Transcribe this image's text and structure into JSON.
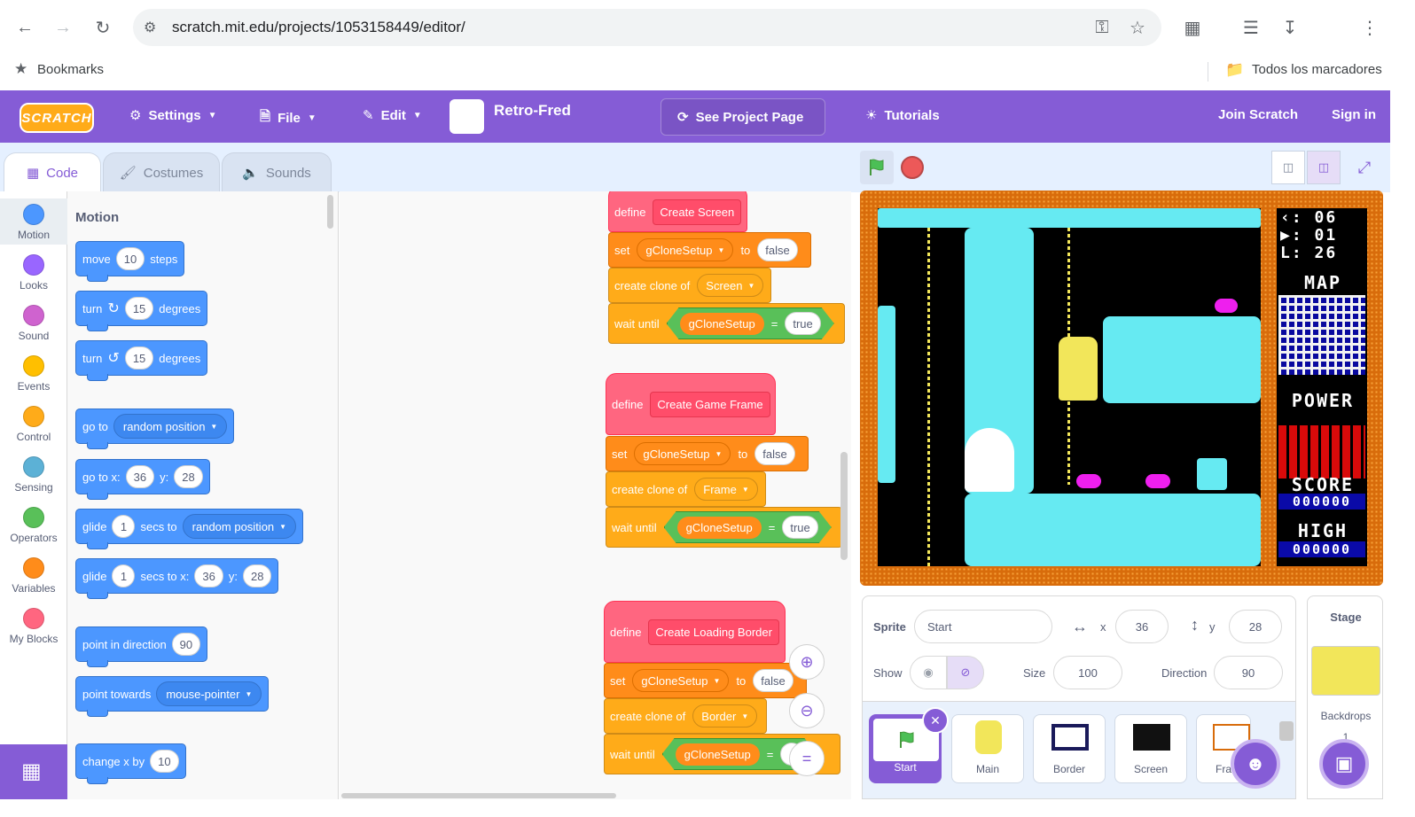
{
  "browser": {
    "url": "scratch.mit.edu/projects/1053158449/editor/",
    "bookmarks_label": "Bookmarks",
    "all_bookmarks_label": "Todos los marcadores"
  },
  "menu": {
    "logo": "SCRATCH",
    "settings": "Settings",
    "file": "File",
    "edit": "Edit",
    "project_title": "Retro-Fred",
    "see_project_page": "See Project Page",
    "tutorials": "Tutorials",
    "join": "Join Scratch",
    "sign_in": "Sign in"
  },
  "tabs": {
    "code": "Code",
    "costumes": "Costumes",
    "sounds": "Sounds"
  },
  "categories": [
    {
      "label": "Motion",
      "color": "#4c97ff"
    },
    {
      "label": "Looks",
      "color": "#9966ff"
    },
    {
      "label": "Sound",
      "color": "#cf63cf"
    },
    {
      "label": "Events",
      "color": "#ffbf00"
    },
    {
      "label": "Control",
      "color": "#ffab19"
    },
    {
      "label": "Sensing",
      "color": "#5cb1d6"
    },
    {
      "label": "Operators",
      "color": "#59c059"
    },
    {
      "label": "Variables",
      "color": "#ff8c1a"
    },
    {
      "label": "My Blocks",
      "color": "#ff6680"
    }
  ],
  "palette": {
    "section": "Motion",
    "move": {
      "a": "move",
      "v": "10",
      "b": "steps"
    },
    "turn_right": {
      "a": "turn",
      "v": "15",
      "b": "degrees"
    },
    "turn_left": {
      "a": "turn",
      "v": "15",
      "b": "degrees"
    },
    "goto": {
      "a": "go to",
      "d": "random position"
    },
    "gotoxy": {
      "a": "go to x:",
      "x": "36",
      "b": "y:",
      "y": "28"
    },
    "glide": {
      "a": "glide",
      "v": "1",
      "b": "secs to",
      "d": "random position"
    },
    "glidexy": {
      "a": "glide",
      "v": "1",
      "b": "secs to x:",
      "x": "36",
      "c": "y:",
      "y": "28"
    },
    "point_dir": {
      "a": "point in direction",
      "v": "90"
    },
    "point_towards": {
      "a": "point towards",
      "d": "mouse-pointer"
    },
    "change_x": {
      "a": "change x by",
      "v": "10"
    }
  },
  "scripts": [
    {
      "define": "define",
      "name": "Create Screen",
      "set": "set",
      "var": "gCloneSetup",
      "to": "to",
      "val": "false",
      "clone": "create clone of",
      "target": "Screen",
      "wait": "wait until",
      "eq": "=",
      "rhs": "true"
    },
    {
      "define": "define",
      "name": "Create Game Frame",
      "set": "set",
      "var": "gCloneSetup",
      "to": "to",
      "val": "false",
      "clone": "create clone of",
      "target": "Frame",
      "wait": "wait until",
      "eq": "=",
      "rhs": "true"
    },
    {
      "define": "define",
      "name": "Create Loading Border",
      "set": "set",
      "var": "gCloneSetup",
      "to": "to",
      "val": "false",
      "clone": "create clone of",
      "target": "Border",
      "wait": "wait until",
      "eq": "="
    }
  ],
  "hud": {
    "stat1": "‹: 06",
    "stat2": "▶: 01",
    "stat3": "L: 26",
    "map": "MAP",
    "power": "POWER",
    "score": "SCORE",
    "score_val": "000000",
    "high": "HIGH",
    "high_val": "000000"
  },
  "sprite_info": {
    "sprite_label": "Sprite",
    "sprite_name": "Start",
    "x_label": "x",
    "x": "36",
    "y_label": "y",
    "y": "28",
    "show_label": "Show",
    "size_label": "Size",
    "size": "100",
    "direction_label": "Direction",
    "direction": "90"
  },
  "sprites": [
    "Start",
    "Main",
    "Border",
    "Screen",
    "Fra"
  ],
  "stage_panel": {
    "title": "Stage",
    "backdrops_label": "Backdrops",
    "backdrops_count": "1"
  }
}
